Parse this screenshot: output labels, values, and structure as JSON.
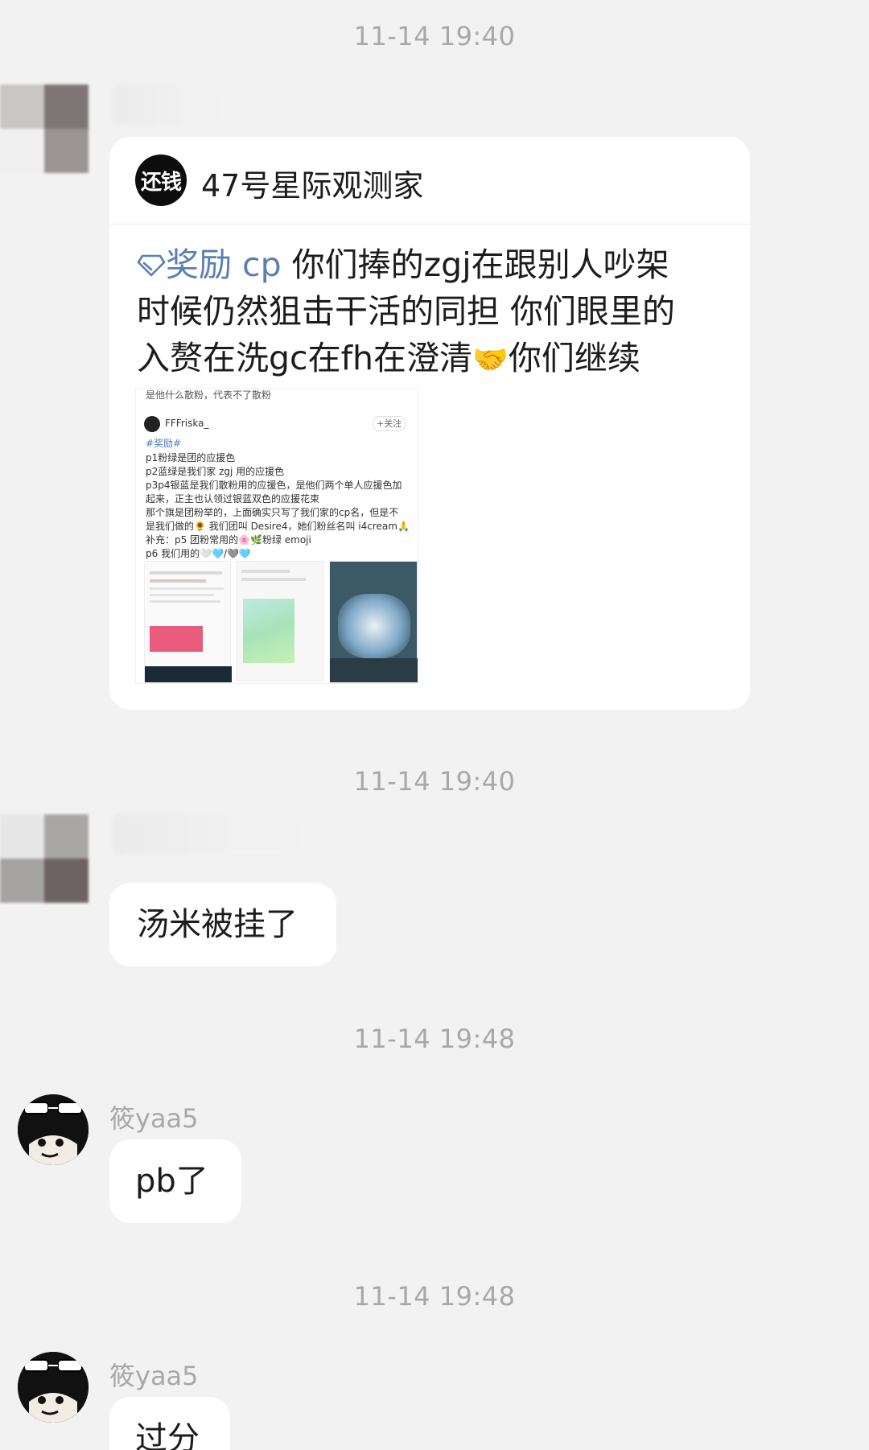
{
  "messages": [
    {
      "timestamp": "11-14 19:40",
      "card": {
        "logo_text": "还钱",
        "title": "47号星际观测家",
        "tag": "奖励 cp",
        "body_lines": [
          "你们捧的zgj在跟别人吵架",
          "时候仍然狙击干活的同担 你们眼里的",
          "入赘在洗gc在fh在澄清",
          "你们继续"
        ],
        "handshake_emoji": "🤝",
        "embedded_post": {
          "top_caption": "是他什么散粉，代表不了散粉",
          "username": "FFFriska_",
          "follow_label": "+关注",
          "hashtag": "#奖励#",
          "lines": [
            "p1粉绿是团的应援色",
            "p2蓝绿是我们家 zgj 用的应援色",
            "p3p4银蓝是我们散粉用的应援色，是他们两个单人应援色加",
            "起来，正主也认领过银蓝双色的应援花束",
            "那个旗是团粉举的，上面确实只写了我们家的cp名，但是不",
            "是我们做的🌻 我们团叫 Desire4，她们粉丝名叫 i4cream🙏",
            "补充：p5 团粉常用的🌸🌿粉绿 emoji",
            "p6 我们用的🤍🩵/🩶🩵"
          ]
        }
      }
    },
    {
      "timestamp": "11-14 19:40",
      "text": "汤米被挂了"
    },
    {
      "timestamp": "11-14 19:48",
      "sender": "筱yaa5",
      "text": "pb了"
    },
    {
      "timestamp": "11-14 19:48",
      "sender": "筱yaa5",
      "text": "过分"
    }
  ]
}
